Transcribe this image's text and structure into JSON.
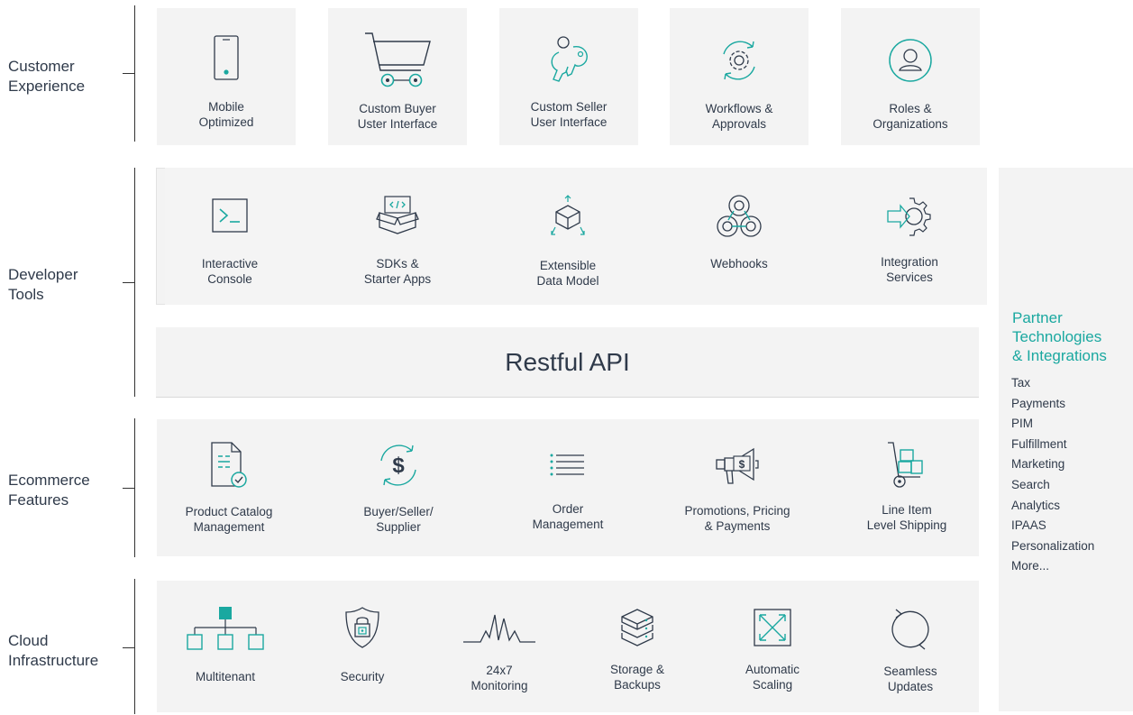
{
  "colors": {
    "accent": "#1aa8a0",
    "ink": "#2f3a4a",
    "panel": "#f3f3f3"
  },
  "layers": {
    "customer": {
      "label": "Customer\nExperience"
    },
    "developer": {
      "label": "Developer\nTools"
    },
    "ecommerce": {
      "label": "Ecommerce\nFeatures"
    },
    "cloud": {
      "label": "Cloud\nInfrastructure"
    }
  },
  "customer_items": [
    {
      "label": "Mobile\nOptimized",
      "icon": "mobile-phone-icon"
    },
    {
      "label": "Custom Buyer\nUster Interface",
      "icon": "shopping-cart-icon"
    },
    {
      "label": "Custom Seller\nUser Interface",
      "icon": "keys-icon"
    },
    {
      "label": "Workflows &\nApprovals",
      "icon": "gear-cycle-icon"
    },
    {
      "label": "Roles &\nOrganizations",
      "icon": "user-icon"
    }
  ],
  "developer_items": [
    {
      "label": "Interactive\nConsole",
      "icon": "terminal-icon"
    },
    {
      "label": "SDKs &\nStarter Apps",
      "icon": "code-box-icon"
    },
    {
      "label": "Extensible\nData Model",
      "icon": "cube-icon"
    },
    {
      "label": "Webhooks",
      "icon": "webhook-icon"
    },
    {
      "label": "Integration\nServices",
      "icon": "integration-gear-icon"
    }
  ],
  "api": {
    "label": "Restful API"
  },
  "ecommerce_items": [
    {
      "label": "Product Catalog\nManagement",
      "icon": "document-check-icon"
    },
    {
      "label": "Buyer/Seller/\nSupplier",
      "icon": "dollar-cycle-icon"
    },
    {
      "label": "Order\nManagement",
      "icon": "list-icon"
    },
    {
      "label": "Promotions, Pricing\n& Payments",
      "icon": "megaphone-icon"
    },
    {
      "label": "Line Item\nLevel Shipping",
      "icon": "hand-truck-icon"
    }
  ],
  "cloud_items": [
    {
      "label": "Multitenant",
      "icon": "hierarchy-icon"
    },
    {
      "label": "Security",
      "icon": "shield-lock-icon"
    },
    {
      "label": "24x7\nMonitoring",
      "icon": "pulse-icon"
    },
    {
      "label": "Storage &\nBackups",
      "icon": "server-stack-icon"
    },
    {
      "label": "Automatic\nScaling",
      "icon": "scale-arrows-icon"
    },
    {
      "label": "Seamless\nUpdates",
      "icon": "refresh-icon"
    }
  ],
  "partner": {
    "title": "Partner\nTechnologies\n& Integrations",
    "items": [
      "Tax",
      "Payments",
      "PIM",
      "Fulfillment",
      "Marketing",
      "Search",
      "Analytics",
      "IPAAS",
      "Personalization",
      "More..."
    ]
  }
}
